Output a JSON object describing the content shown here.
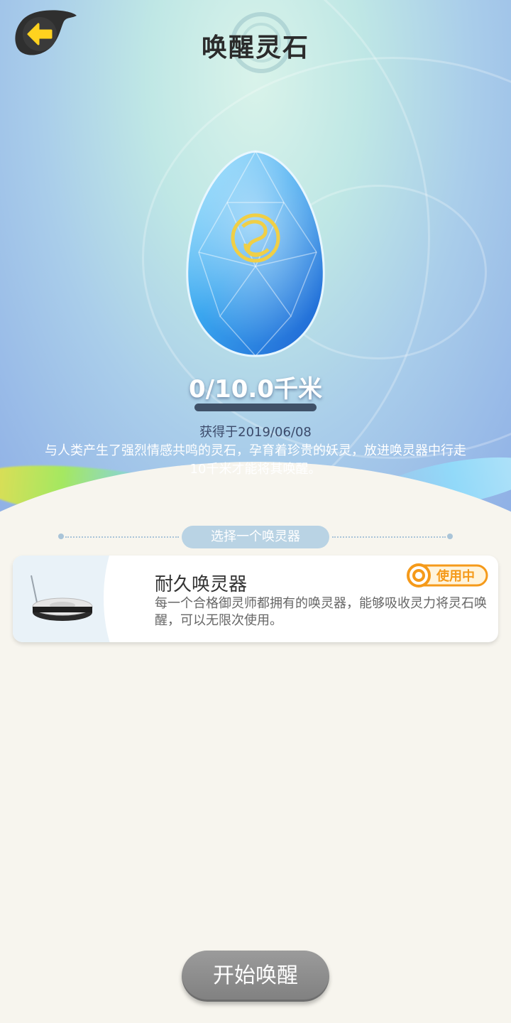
{
  "header": {
    "title": "唤醒灵石",
    "back_icon": "back-arrow-icon"
  },
  "stone": {
    "progress_text": "0/10.0千米",
    "progress_fraction": 0.0,
    "obtained_text": "获得于2019/06/08",
    "description": "与人类产生了强烈情感共鸣的灵石，孕育着珍贵的妖灵，放进唤灵器中行走10千米才能将其唤醒。"
  },
  "section": {
    "label": "选择一个唤灵器"
  },
  "device_card": {
    "title": "耐久唤灵器",
    "description": "每一个合格御灵师都拥有的唤灵器，能够吸收灵力将灵石唤醒，可以无限次使用。",
    "badge": "使用中",
    "badge_color": "#f59a1a"
  },
  "footer": {
    "start_button": "开始唤醒"
  },
  "colors": {
    "accent_yellow": "#ffd23a",
    "button_gray": "#8c8c8c"
  }
}
